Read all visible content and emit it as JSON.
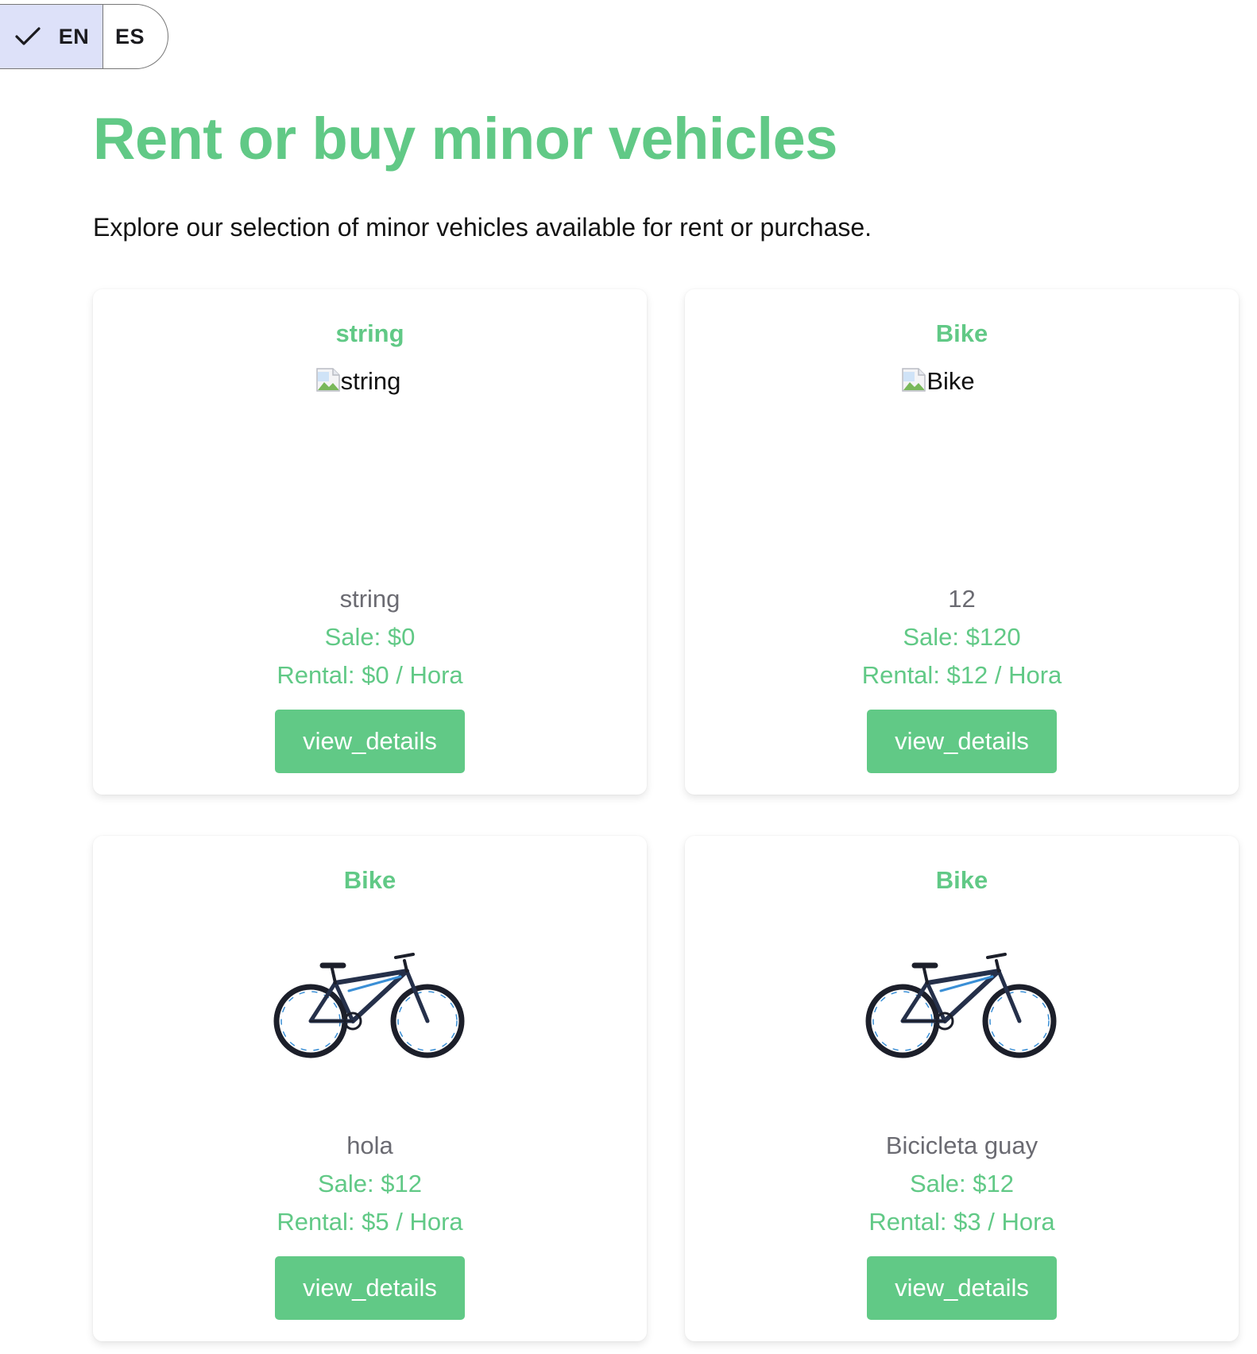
{
  "language_toggle": {
    "options": [
      {
        "label": "EN",
        "selected": true
      },
      {
        "label": "ES",
        "selected": false
      }
    ]
  },
  "header": {
    "title": "Rent or buy minor vehicles",
    "subtitle": "Explore our selection of minor vehicles available for rent or purchase."
  },
  "colors": {
    "accent": "#61c986",
    "toggle_selected_bg": "#dde1f9",
    "muted_text": "#6b6b72"
  },
  "vehicles": [
    {
      "title": "string",
      "image_alt": "string",
      "image_loaded": false,
      "description": "string",
      "sale": "Sale: $0",
      "rental": "Rental: $0 / Hora",
      "button_label": "view_details"
    },
    {
      "title": "Bike",
      "image_alt": "Bike",
      "image_loaded": false,
      "description": "12",
      "sale": "Sale: $120",
      "rental": "Rental: $12 / Hora",
      "button_label": "view_details"
    },
    {
      "title": "Bike",
      "image_alt": "bike-photo",
      "image_loaded": true,
      "description": "hola",
      "sale": "Sale: $12",
      "rental": "Rental: $5 / Hora",
      "button_label": "view_details"
    },
    {
      "title": "Bike",
      "image_alt": "bike-photo",
      "image_loaded": true,
      "description": "Bicicleta guay",
      "sale": "Sale: $12",
      "rental": "Rental: $3 / Hora",
      "button_label": "view_details"
    }
  ]
}
